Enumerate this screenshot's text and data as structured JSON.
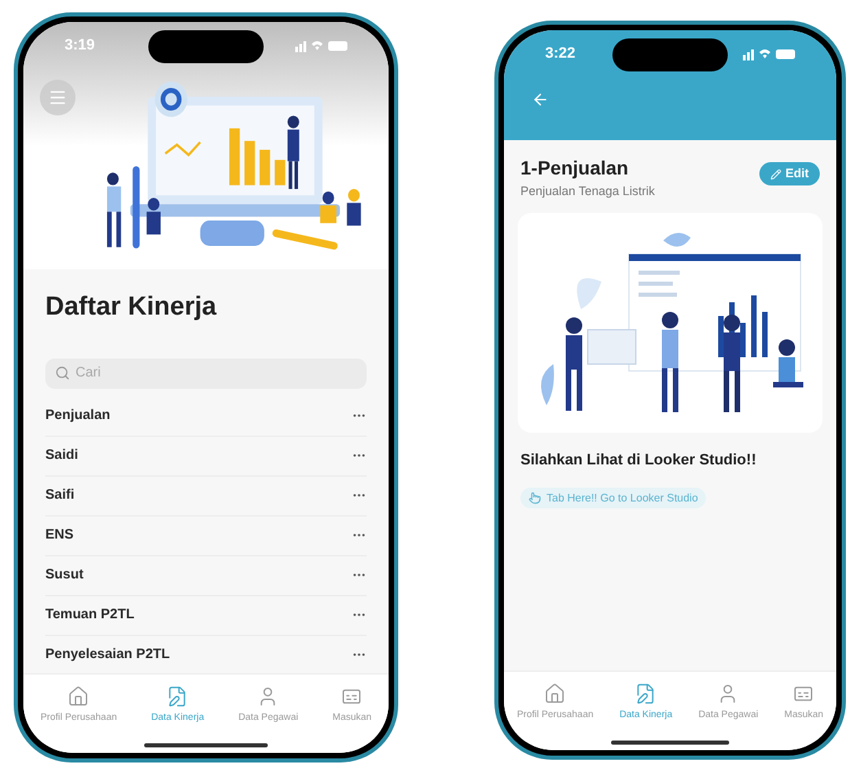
{
  "phones": [
    {
      "kind": "list",
      "status_bar": {
        "time": "3:19"
      },
      "title": "Daftar Kinerja",
      "search": {
        "placeholder": "Cari"
      },
      "items": [
        {
          "label": "Penjualan"
        },
        {
          "label": "Saidi"
        },
        {
          "label": "Saifi"
        },
        {
          "label": "ENS"
        },
        {
          "label": "Susut"
        },
        {
          "label": "Temuan P2TL"
        },
        {
          "label": "Penyelesaian P2TL"
        }
      ],
      "nav": [
        {
          "label": "Profil Perusahaan",
          "selected": false
        },
        {
          "label": "Data Kinerja",
          "selected": true
        },
        {
          "label": "Data Pegawai",
          "selected": false
        },
        {
          "label": "Masukan",
          "selected": false
        }
      ]
    },
    {
      "kind": "detail",
      "status_bar": {
        "time": "3:22"
      },
      "title": "1-Penjualan",
      "subtitle": "Penjualan Tenaga Listrik",
      "edit_button": "Edit",
      "heading": "Silahkan Lihat di Looker Studio!!",
      "link": "Tab Here!! Go to Looker Studio",
      "nav": [
        {
          "label": "Profil Perusahaan",
          "selected": false
        },
        {
          "label": "Data Kinerja",
          "selected": true
        },
        {
          "label": "Data Pegawai",
          "selected": false
        },
        {
          "label": "Masukan",
          "selected": false
        }
      ]
    }
  ]
}
